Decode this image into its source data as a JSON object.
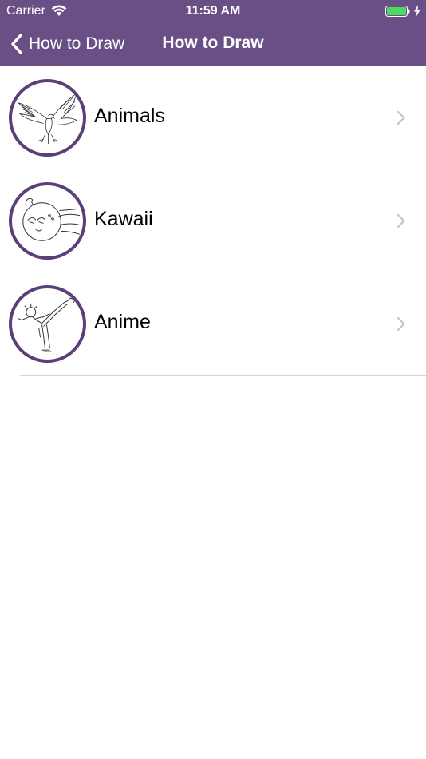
{
  "status_bar": {
    "carrier": "Carrier",
    "time": "11:59 AM",
    "wifi_icon": "wifi-icon",
    "battery_icon": "battery-icon",
    "battery_color": "#4cd964"
  },
  "nav_bar": {
    "back_label": "How to Draw",
    "title": "How to Draw",
    "background_color": "#694f86"
  },
  "list": {
    "items": [
      {
        "label": "Animals",
        "thumbnail": "eagle-drawing"
      },
      {
        "label": "Kawaii",
        "thumbnail": "kawaii-face-drawing"
      },
      {
        "label": "Anime",
        "thumbnail": "anime-kick-drawing"
      }
    ]
  }
}
